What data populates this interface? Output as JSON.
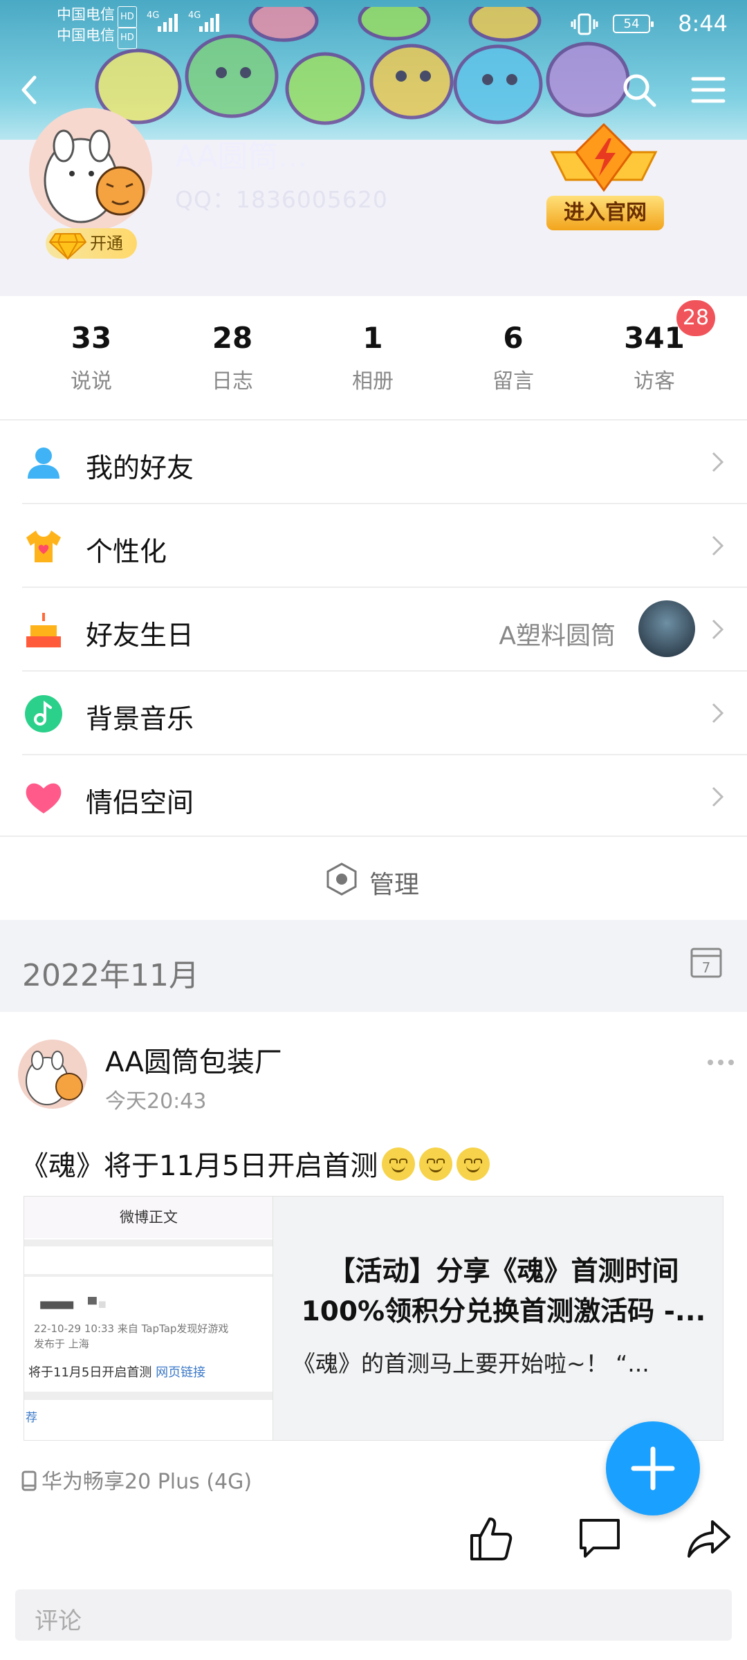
{
  "status_bar": {
    "carrier_1": "中国电信",
    "carrier_2": "中国电信",
    "hd_1": "HD",
    "hd_2": "HD",
    "network_1": "4G",
    "network_2": "4G",
    "battery": "54",
    "time": "8:44"
  },
  "header": {
    "banner_icons": [
      "back-icon",
      "search-icon",
      "menu-icon"
    ],
    "profile_name": "AA圆筒...",
    "qq_number": "QQ：1836005620",
    "vip_label": "开通",
    "official_label": "进入官网"
  },
  "stats": [
    {
      "value": "33",
      "label": "说说"
    },
    {
      "value": "28",
      "label": "日志"
    },
    {
      "value": "1",
      "label": "相册"
    },
    {
      "value": "6",
      "label": "留言"
    },
    {
      "value": "341",
      "label": "访客"
    }
  ],
  "visitor_badge": "28",
  "menu": [
    {
      "label": "我的好友",
      "icon": "friends-icon"
    },
    {
      "label": "个性化",
      "icon": "tshirt-icon"
    },
    {
      "label": "好友生日",
      "icon": "cake-icon",
      "extra": "A塑料圆筒"
    },
    {
      "label": "背景音乐",
      "icon": "music-icon"
    },
    {
      "label": "情侣空间",
      "icon": "heart-icon"
    }
  ],
  "manage_label": "管理",
  "section_date": "2022年11月",
  "calendar_day": "7",
  "post": {
    "author": "AA圆筒包装厂",
    "time": "今天20:43",
    "text": "《魂》将于11月5日开启首测",
    "card": {
      "thumb_header": "微博正文",
      "thumb_meta_1": "22-10-29 10:33  来自 TapTap发现好游戏",
      "thumb_meta_2": "发布于 上海",
      "thumb_link_text": "将于11月5日开启首测",
      "thumb_link": "网页链接",
      "thumb_rec": "荐",
      "title_line_1": "【活动】分享《魂》首测时间",
      "title_line_2": "100%领积分兑换首测激活码 -...",
      "desc": "《魂》的首测马上要开始啦~！ “..."
    },
    "device": "华为畅享20 Plus (4G)",
    "comment_placeholder": "评论"
  },
  "colors": {
    "accent_blue": "#1aa1ff",
    "badge_red": "#f0545a",
    "section_bg": "#f2f3f7"
  }
}
